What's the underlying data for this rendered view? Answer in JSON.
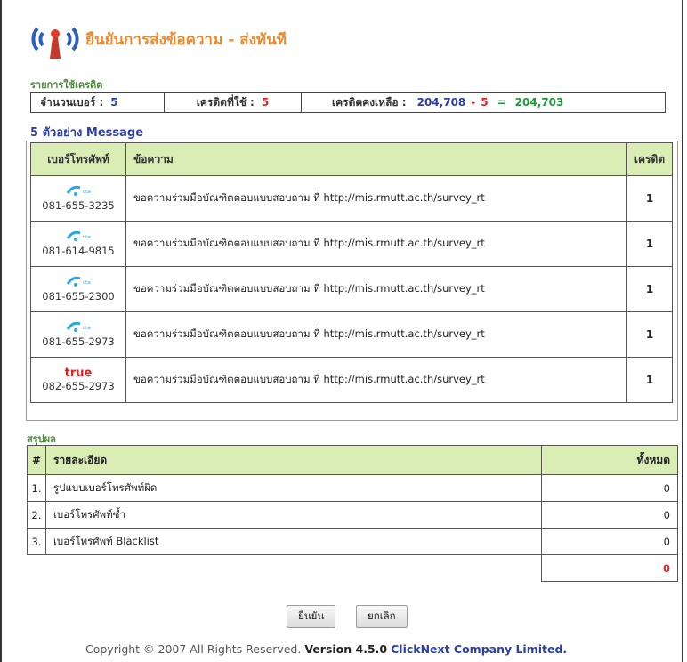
{
  "header": {
    "title": "ยืนยันการส่งข้อความ - ส่งทันที"
  },
  "credit_section": {
    "label": "รายการใช้เครดิต",
    "count_label": "จำนวนเบอร์ :",
    "count_value": "5",
    "used_label": "เครดิตที่ใช้ :",
    "used_value": "5",
    "remaining_label": "เครดิตคงเหลือ :",
    "remaining_before": "204,708",
    "minus": "-",
    "remaining_used": "5",
    "equals": "=",
    "remaining_after": "204,703"
  },
  "messages": {
    "title": "5 ตัวอย่าง Message",
    "columns": [
      "เบอร์โทรศัพท์",
      "ข้อความ",
      "เครดิต"
    ],
    "rows": [
      {
        "carrier": "dtac",
        "phone": "081-655-3235",
        "text": "ขอความร่วมมือบัณฑิตตอบแบบสอบถาม ที่ http://mis.rmutt.ac.th/survey_rt",
        "credit": "1"
      },
      {
        "carrier": "dtac",
        "phone": "081-614-9815",
        "text": "ขอความร่วมมือบัณฑิตตอบแบบสอบถาม ที่ http://mis.rmutt.ac.th/survey_rt",
        "credit": "1"
      },
      {
        "carrier": "dtac",
        "phone": "081-655-2300",
        "text": "ขอความร่วมมือบัณฑิตตอบแบบสอบถาม ที่ http://mis.rmutt.ac.th/survey_rt",
        "credit": "1"
      },
      {
        "carrier": "dtac",
        "phone": "081-655-2973",
        "text": "ขอความร่วมมือบัณฑิตตอบแบบสอบถาม ที่ http://mis.rmutt.ac.th/survey_rt",
        "credit": "1"
      },
      {
        "carrier": "true",
        "carrier_label": "true",
        "phone": "082-655-2973",
        "text": "ขอความร่วมมือบัณฑิตตอบแบบสอบถาม ที่ http://mis.rmutt.ac.th/survey_rt",
        "credit": "1"
      }
    ]
  },
  "summary": {
    "label": "สรุปผล",
    "columns": [
      "#",
      "รายละเอียด",
      "ทั้งหมด"
    ],
    "rows": [
      {
        "num": "1.",
        "desc": "รูปแบบเบอร์โทรศัพท์ผิด",
        "value": "0"
      },
      {
        "num": "2.",
        "desc": "เบอร์โทรศัพท์ซ้ำ",
        "value": "0"
      },
      {
        "num": "3.",
        "desc": "เบอร์โทรศัพท์ Blacklist",
        "value": "0"
      }
    ],
    "total": "0"
  },
  "buttons": {
    "confirm": "ยืนยัน",
    "cancel": "ยกเลิก"
  },
  "footer": {
    "copyright": "Copyright © 2007 All Rights Reserved.",
    "version": "Version 4.5.0",
    "company": "ClickNext Company Limited."
  },
  "colors": {
    "title_orange": "#f08a2c",
    "section_green": "#4d8a3a",
    "header_bg": "#d9edb4",
    "accent_blue": "#2b3fa6",
    "accent_red": "#e02020",
    "accent_green": "#1e9a3b",
    "dtac_blue": "#29a8e0"
  },
  "icons": {
    "app": "antenna-icon",
    "dtac": "dtac-logo-icon"
  }
}
